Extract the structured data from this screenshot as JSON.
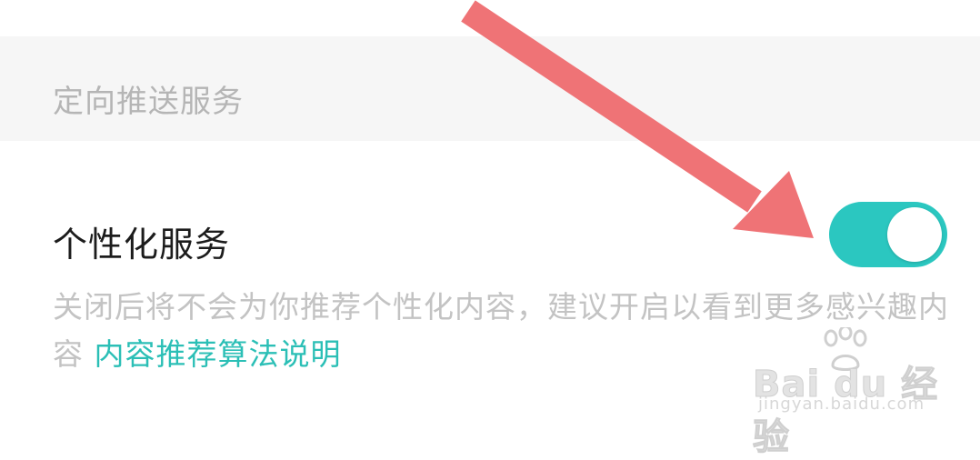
{
  "section": {
    "title": "定向推送服务"
  },
  "item": {
    "title": "个性化服务",
    "description": "关闭后将不会为你推荐个性化内容，建议开启以看到更多感兴趣内容",
    "link_text": "内容推荐算法说明",
    "toggle_on": true
  },
  "watermark": {
    "logo_text": "Bai du 经验",
    "url": "jingyan.baidu.com"
  },
  "colors": {
    "accent": "#2bc7c0",
    "link": "#2bbfb6",
    "arrow": "#ef7376",
    "section_bg": "#f6f6f6"
  },
  "icons": {
    "arrow": "red-arrow-icon",
    "paw": "baidu-paw-icon"
  }
}
